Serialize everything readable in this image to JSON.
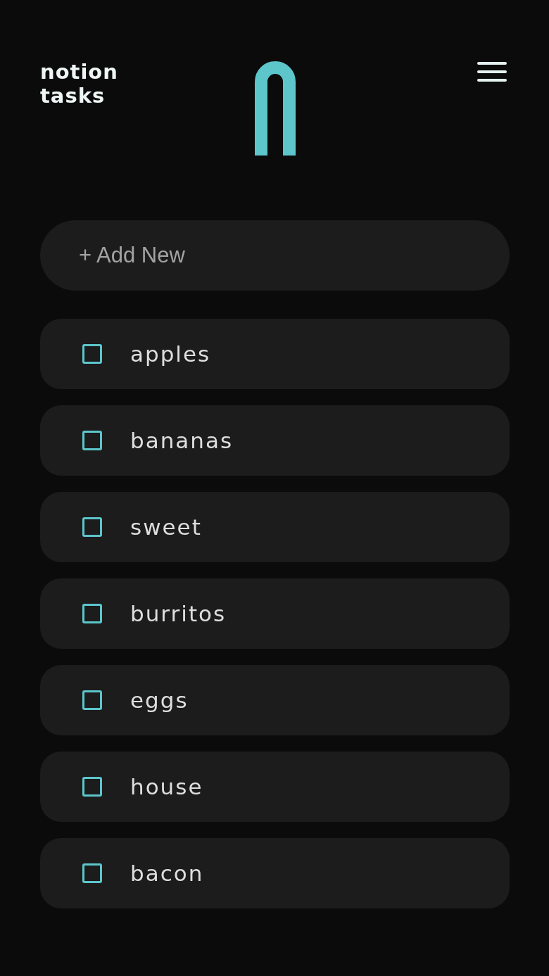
{
  "header": {
    "logo": "notion tasks"
  },
  "add_new": {
    "placeholder": "+ Add New"
  },
  "tasks": [
    {
      "label": "apples",
      "checked": false
    },
    {
      "label": "bananas",
      "checked": false
    },
    {
      "label": "sweet",
      "checked": false
    },
    {
      "label": "burritos",
      "checked": false
    },
    {
      "label": "eggs",
      "checked": false
    },
    {
      "label": "house",
      "checked": false
    },
    {
      "label": "bacon",
      "checked": false
    }
  ]
}
